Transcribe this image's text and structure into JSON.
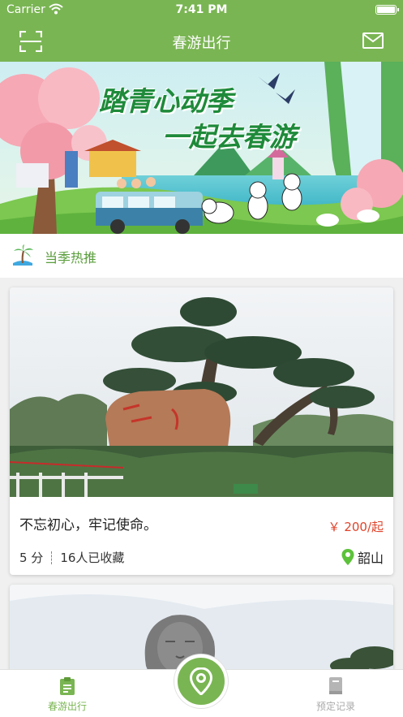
{
  "status_bar": {
    "carrier": "Carrier",
    "time": "7:41 PM"
  },
  "nav": {
    "title": "春游出行",
    "left_icon": "scan-icon",
    "right_icon": "mail-icon"
  },
  "banner": {
    "line1": "踏青心动季",
    "line2": "一起去春游"
  },
  "section": {
    "title": "当季热推",
    "icon": "palm-tree-icon"
  },
  "cards": [
    {
      "title": "不忘初心，牢记使命。",
      "price": "￥ 200/起",
      "duration": "5 分",
      "favorites": "16人已收藏",
      "location": "韶山"
    },
    {
      "title": "",
      "price": "",
      "duration": "",
      "favorites": "",
      "location": ""
    }
  ],
  "tabs": {
    "home": "春游出行",
    "center_icon": "location-pin-icon",
    "records": "预定记录"
  },
  "colors": {
    "brand_green": "#7ab553",
    "price_red": "#e0442b",
    "location_green": "#5cc23a"
  }
}
